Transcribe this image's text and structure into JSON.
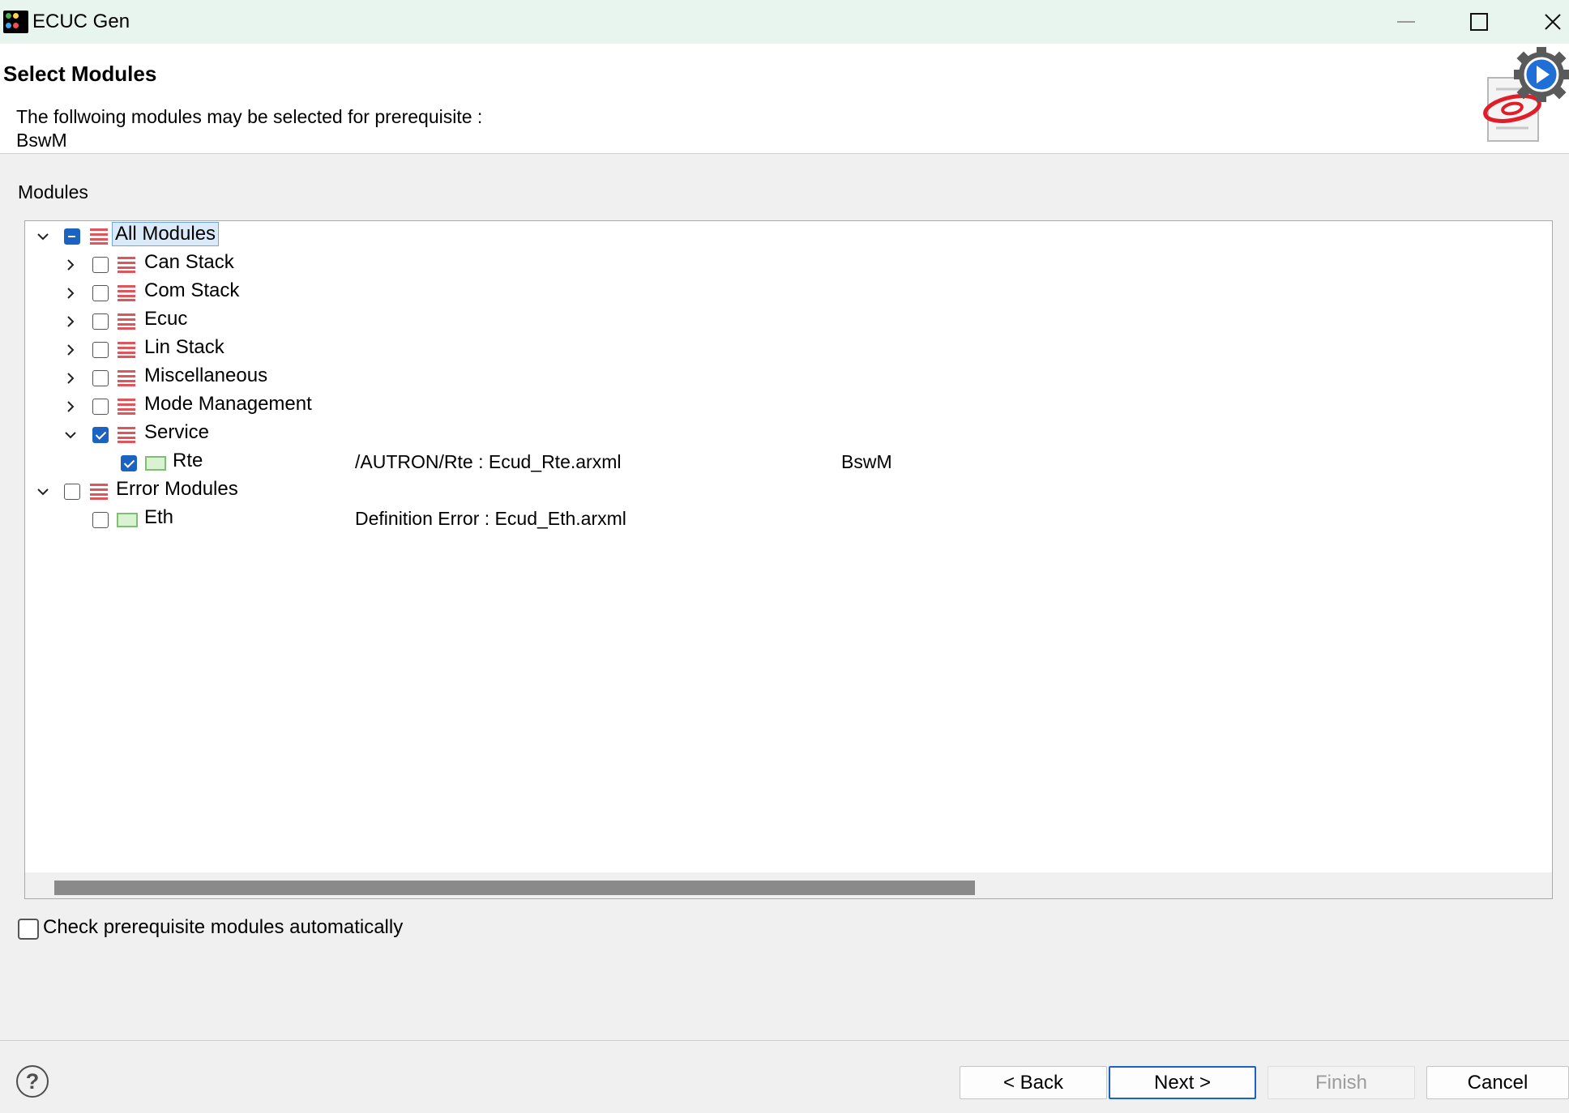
{
  "window": {
    "title": "ECUC Gen"
  },
  "banner": {
    "title": "Select Modules",
    "description": "The follwoing modules may be selected for prerequisite :",
    "prerequisite": "BswM"
  },
  "modules_label": "Modules",
  "tree": {
    "all": {
      "label": "All Modules",
      "state": "partial",
      "expanded": true
    },
    "groups": [
      {
        "label": "Can Stack",
        "checked": false,
        "expanded": false
      },
      {
        "label": "Com Stack",
        "checked": false,
        "expanded": false
      },
      {
        "label": "Ecuc",
        "checked": false,
        "expanded": false
      },
      {
        "label": "Lin Stack",
        "checked": false,
        "expanded": false
      },
      {
        "label": "Miscellaneous",
        "checked": false,
        "expanded": false
      },
      {
        "label": "Mode Management",
        "checked": false,
        "expanded": false
      },
      {
        "label": "Service",
        "checked": true,
        "expanded": true
      }
    ],
    "service_child": {
      "label": "Rte",
      "path": "/AUTRON/Rte : Ecud_Rte.arxml",
      "prerequisite": "BswM",
      "checked": true
    },
    "error": {
      "label": "Error Modules",
      "checked": false,
      "expanded": true
    },
    "error_child": {
      "label": "Eth",
      "path": "Definition Error : Ecud_Eth.arxml",
      "checked": false
    }
  },
  "auto_check": {
    "label": "Check prerequisite modules automatically",
    "checked": false
  },
  "buttons": {
    "help": "?",
    "back": "< Back",
    "next": "Next >",
    "finish": "Finish",
    "cancel": "Cancel"
  },
  "colors": {
    "accent": "#1a63c2",
    "folder_icon": "#e0555a",
    "module_icon": "#7fbf72"
  },
  "icons": {
    "folder": "stack-icon",
    "module": "module-icon"
  }
}
